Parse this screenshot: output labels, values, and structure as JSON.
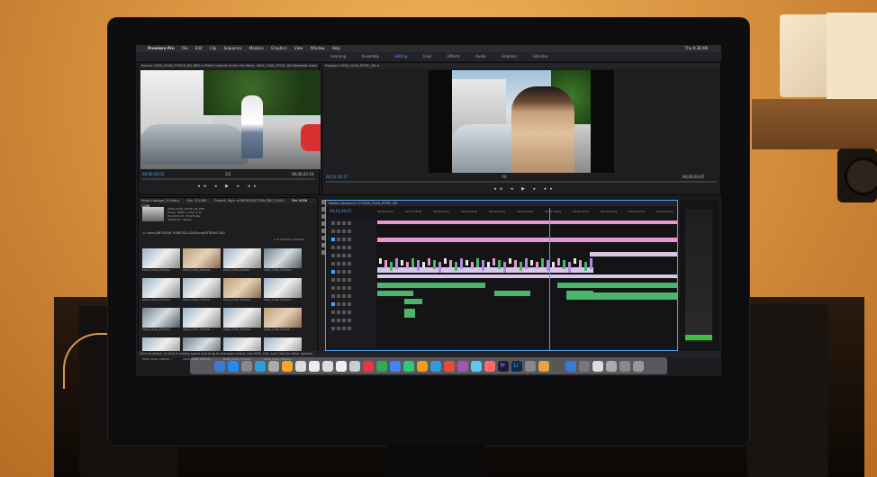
{
  "menubar": {
    "app": "Premiere Pro",
    "items": [
      "File",
      "Edit",
      "Clip",
      "Sequence",
      "Markers",
      "Graphics",
      "View",
      "Window",
      "Help"
    ],
    "clock": "Thu 8:38 AM"
  },
  "workspaces": {
    "tabs": [
      "Learning",
      "Assembly",
      "Editing",
      "Color",
      "Effects",
      "Audio",
      "Graphics",
      "Libraries",
      "Editing"
    ],
    "active_index": 2
  },
  "source_panel": {
    "tabs": "Source: 0004_C046_ST0916_AN_R6D ≡   Effect Controls   Audio Clip Mixer: 0004_C046_ST09F_AN   Metadata   Audio Track M",
    "timecode_left": "00;00;28;03",
    "fit": "1/2",
    "timecode_right": "00;00;22;10"
  },
  "program_panel": {
    "tabs": "Program: 0004_C046_ST09F_AN ≡",
    "timecode_left": "00;22;19;17",
    "fit": "Fit",
    "timecode_right": "00;03;50;07"
  },
  "transport": "◂◂ ◂ ▶ ▸ ▸▸",
  "project_panel": {
    "tabs": [
      "Video Footage (3 Clean)",
      "Bin: 22L000",
      "Project: Topic of INTRODUCTION (REC) 0001",
      "Bin: 0006 C046"
    ],
    "active_tab": 3,
    "meta": "0004_C046_ST09F_AN_R6D\nMovie, 3840 x 2160 (1.0)\n00:00:13:15, 23.976 fps\n48000 Hz - Stereo",
    "bin_path": "Users/ANTHONY HUNT/SUL-DISCprod/DTEAM-CNU",
    "items_selected": "1 of 76 items selected",
    "thumbs": [
      "0004_C046_ST0916...",
      "0004_C046_ST0916...",
      "0004_C046_D0025...",
      "0004_C046_ST0916...",
      "0004_C046_ST0916...",
      "0004_C046_ST0916...",
      "0004_C046_ST0916...",
      "0004_C046_ST0916...",
      "0004_C046_ST0916...",
      "0004_C046_ST0916...",
      "0004_C046_ST0916...",
      "0004_C046_D0025...",
      "0004_C046_ST0916...",
      "0004_C046_ST0916...",
      "0004_C046_ST0916...",
      "0004_C046_ST0916..."
    ]
  },
  "timeline": {
    "tabs": "Master Sequence 03   0004_C046_ST09F_AN",
    "timecode": "00;22;19;17",
    "ruler": [
      "00;16;54;13",
      "00;17;38;15",
      "00;18;22;17",
      "00;19;06;19",
      "00;19;50;21",
      "00;20;34;23",
      "00;21;18;25",
      "00;22;02;27",
      "00;22;46;29",
      "00;23;30;31",
      "00;24;14;33"
    ]
  },
  "status_bar": "Click to select, or click in empty space and drag to marquee select. Use Shift, Opt, and Cmd for other options.",
  "dock": {
    "labels": [
      "Pr",
      "Lr"
    ]
  },
  "colors": {
    "accent": "#4ea1ff",
    "clip_video": "#d8c7e8",
    "clip_audio": "#4bb56b",
    "clip_pink": "#e49ad3"
  }
}
